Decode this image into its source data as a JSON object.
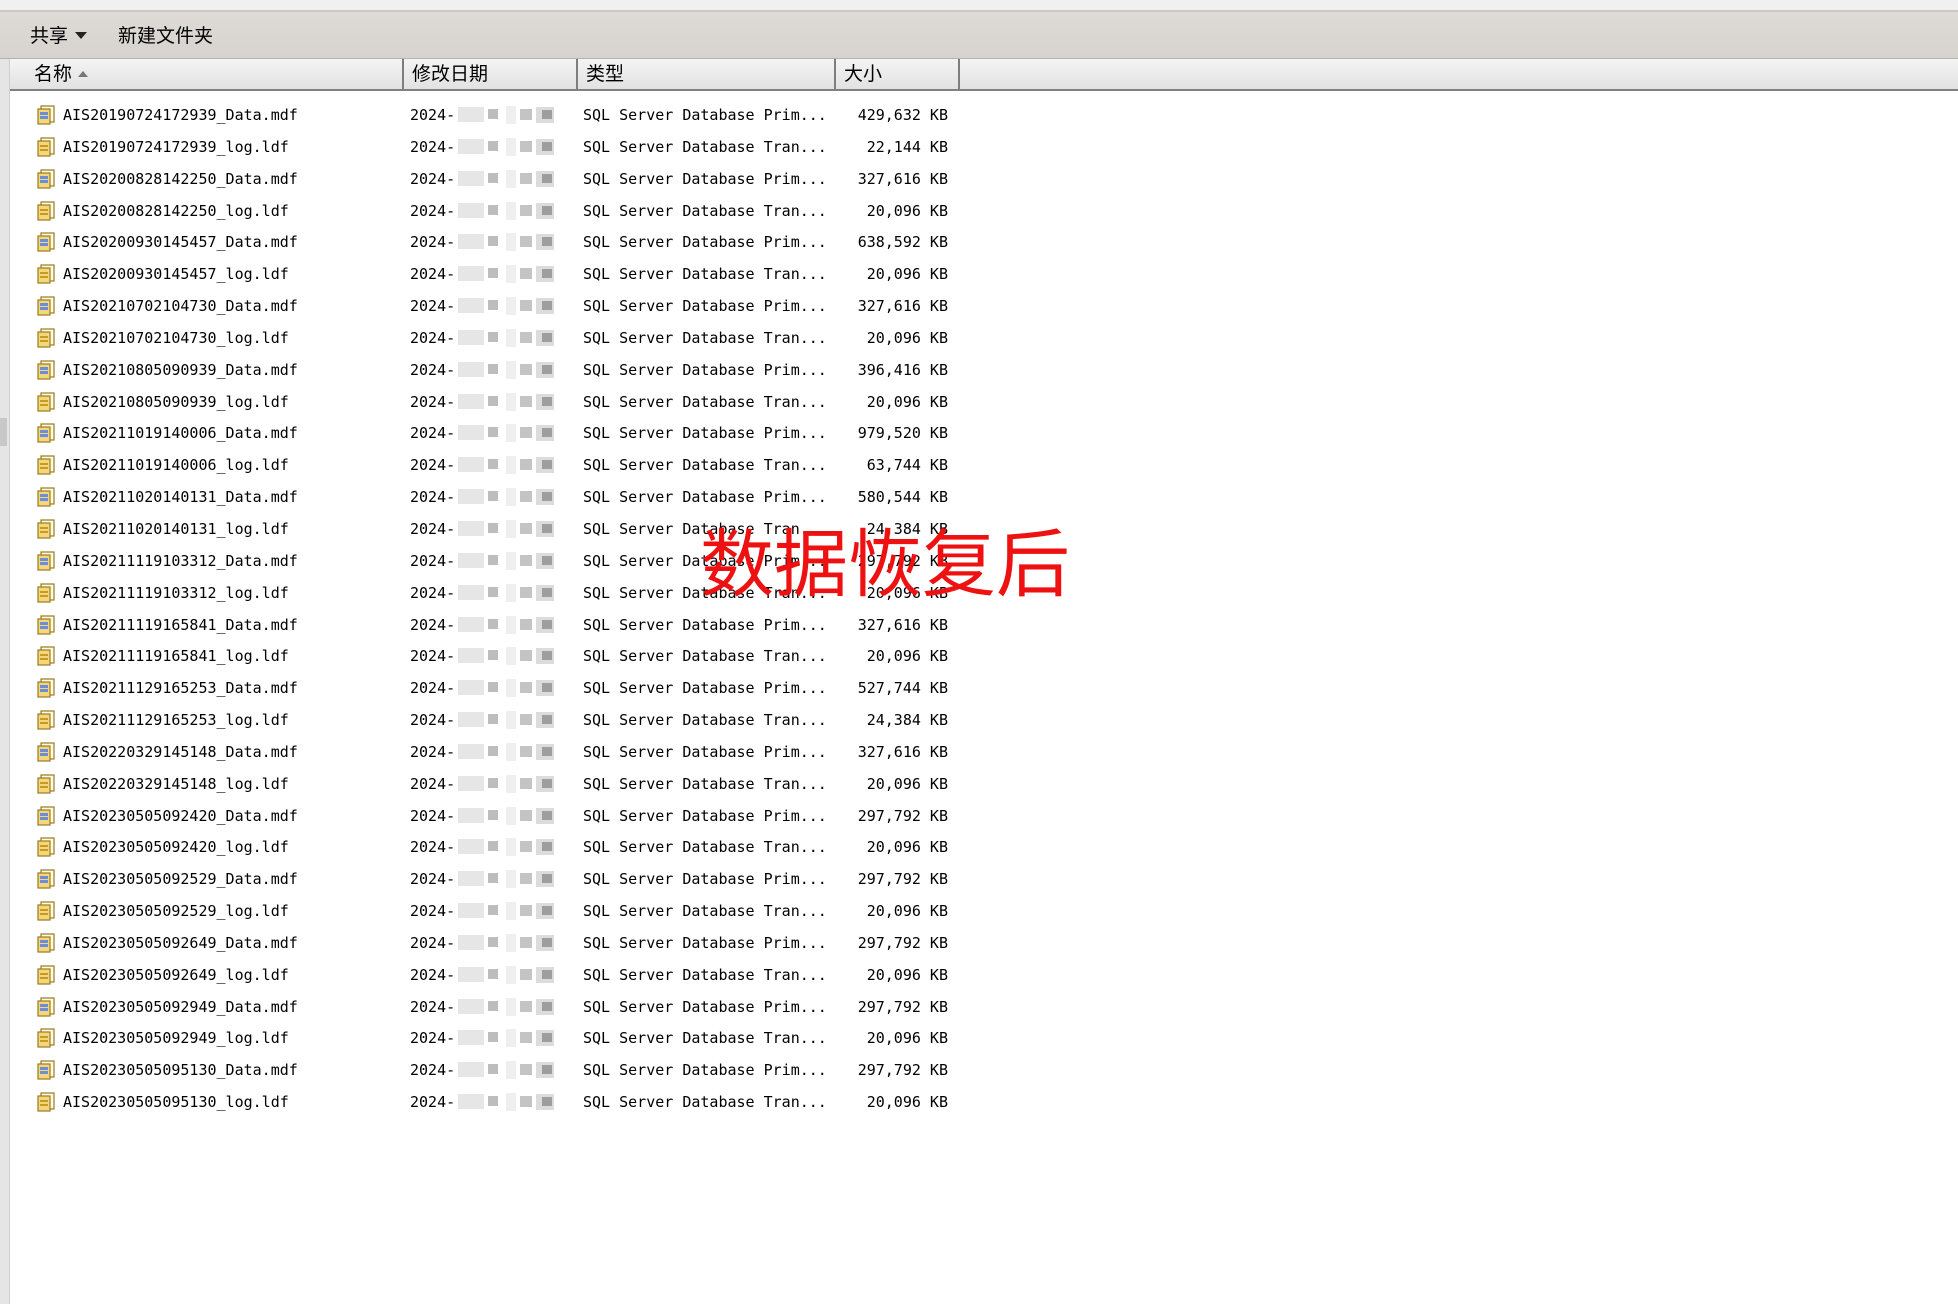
{
  "toolbar": {
    "share_label": "共享",
    "new_folder_label": "新建文件夹"
  },
  "columns": {
    "name": "名称",
    "date": "修改日期",
    "type": "类型",
    "size": "大小"
  },
  "overlay_text": "数据恢复后",
  "accent_color": "#ee1111",
  "files": [
    {
      "name": "AIS20190724172939_Data.mdf",
      "date": "2024-(",
      "type": "SQL Server Database Prim...",
      "size": "429,632 KB",
      "kind": "mdf-icon"
    },
    {
      "name": "AIS20190724172939_log.ldf",
      "date": "2024-(",
      "type": "SQL Server Database Tran...",
      "size": "22,144 KB",
      "kind": "ldf-icon"
    },
    {
      "name": "AIS20200828142250_Data.mdf",
      "date": "2024-(",
      "type": "SQL Server Database Prim...",
      "size": "327,616 KB",
      "kind": "mdf-icon"
    },
    {
      "name": "AIS20200828142250_log.ldf",
      "date": "2024-(",
      "type": "SQL Server Database Tran...",
      "size": "20,096 KB",
      "kind": "ldf-icon"
    },
    {
      "name": "AIS20200930145457_Data.mdf",
      "date": "2024-(",
      "type": "SQL Server Database Prim...",
      "size": "638,592 KB",
      "kind": "mdf-icon"
    },
    {
      "name": "AIS20200930145457_log.ldf",
      "date": "2024-(",
      "type": "SQL Server Database Tran...",
      "size": "20,096 KB",
      "kind": "ldf-icon"
    },
    {
      "name": "AIS20210702104730_Data.mdf",
      "date": "2024-(",
      "type": "SQL Server Database Prim...",
      "size": "327,616 KB",
      "kind": "mdf-icon"
    },
    {
      "name": "AIS20210702104730_log.ldf",
      "date": "2024-(",
      "type": "SQL Server Database Tran...",
      "size": "20,096 KB",
      "kind": "ldf-icon"
    },
    {
      "name": "AIS20210805090939_Data.mdf",
      "date": "2024-(",
      "type": "SQL Server Database Prim...",
      "size": "396,416 KB",
      "kind": "mdf-icon"
    },
    {
      "name": "AIS20210805090939_log.ldf",
      "date": "2024-(",
      "type": "SQL Server Database Tran...",
      "size": "20,096 KB",
      "kind": "ldf-icon"
    },
    {
      "name": "AIS20211019140006_Data.mdf",
      "date": "2024-(",
      "type": "SQL Server Database Prim...",
      "size": "979,520 KB",
      "kind": "mdf-icon"
    },
    {
      "name": "AIS20211019140006_log.ldf",
      "date": "2024-(",
      "type": "SQL Server Database Tran...",
      "size": "63,744 KB",
      "kind": "ldf-icon"
    },
    {
      "name": "AIS20211020140131_Data.mdf",
      "date": "2024-(",
      "type": "SQL Server Database Prim...",
      "size": "580,544 KB",
      "kind": "mdf-icon"
    },
    {
      "name": "AIS20211020140131_log.ldf",
      "date": "2024-(",
      "type": "SQL Server Database Tran...",
      "size": "24,384 KB",
      "kind": "ldf-icon"
    },
    {
      "name": "AIS20211119103312_Data.mdf",
      "date": "2024-(",
      "type": "SQL Server Database Prim...",
      "size": "297,792 KB",
      "kind": "mdf-icon"
    },
    {
      "name": "AIS20211119103312_log.ldf",
      "date": "2024-(",
      "type": "SQL Server Database Tran...",
      "size": "20,096 KB",
      "kind": "ldf-icon"
    },
    {
      "name": "AIS20211119165841_Data.mdf",
      "date": "2024-(",
      "type": "SQL Server Database Prim...",
      "size": "327,616 KB",
      "kind": "mdf-icon"
    },
    {
      "name": "AIS20211119165841_log.ldf",
      "date": "2024-(",
      "type": "SQL Server Database Tran...",
      "size": "20,096 KB",
      "kind": "ldf-icon"
    },
    {
      "name": "AIS20211129165253_Data.mdf",
      "date": "2024-(",
      "type": "SQL Server Database Prim...",
      "size": "527,744 KB",
      "kind": "mdf-icon"
    },
    {
      "name": "AIS20211129165253_log.ldf",
      "date": "2024-(",
      "type": "SQL Server Database Tran...",
      "size": "24,384 KB",
      "kind": "ldf-icon"
    },
    {
      "name": "AIS20220329145148_Data.mdf",
      "date": "2024-(",
      "type": "SQL Server Database Prim...",
      "size": "327,616 KB",
      "kind": "mdf-icon"
    },
    {
      "name": "AIS20220329145148_log.ldf",
      "date": "2024-(",
      "type": "SQL Server Database Tran...",
      "size": "20,096 KB",
      "kind": "ldf-icon"
    },
    {
      "name": "AIS20230505092420_Data.mdf",
      "date": "2024-(",
      "type": "SQL Server Database Prim...",
      "size": "297,792 KB",
      "kind": "mdf-icon"
    },
    {
      "name": "AIS20230505092420_log.ldf",
      "date": "2024-(",
      "type": "SQL Server Database Tran...",
      "size": "20,096 KB",
      "kind": "ldf-icon"
    },
    {
      "name": "AIS20230505092529_Data.mdf",
      "date": "2024-(",
      "type": "SQL Server Database Prim...",
      "size": "297,792 KB",
      "kind": "mdf-icon"
    },
    {
      "name": "AIS20230505092529_log.ldf",
      "date": "2024-(",
      "type": "SQL Server Database Tran...",
      "size": "20,096 KB",
      "kind": "ldf-icon"
    },
    {
      "name": "AIS20230505092649_Data.mdf",
      "date": "2024-(",
      "type": "SQL Server Database Prim...",
      "size": "297,792 KB",
      "kind": "mdf-icon"
    },
    {
      "name": "AIS20230505092649_log.ldf",
      "date": "2024-(",
      "type": "SQL Server Database Tran...",
      "size": "20,096 KB",
      "kind": "ldf-icon"
    },
    {
      "name": "AIS20230505092949_Data.mdf",
      "date": "2024-(",
      "type": "SQL Server Database Prim...",
      "size": "297,792 KB",
      "kind": "mdf-icon"
    },
    {
      "name": "AIS20230505092949_log.ldf",
      "date": "2024-(",
      "type": "SQL Server Database Tran...",
      "size": "20,096 KB",
      "kind": "ldf-icon"
    },
    {
      "name": "AIS20230505095130_Data.mdf",
      "date": "2024-(",
      "type": "SQL Server Database Prim...",
      "size": "297,792 KB",
      "kind": "mdf-icon"
    },
    {
      "name": "AIS20230505095130_log.ldf",
      "date": "2024-(",
      "type": "SQL Server Database Tran...",
      "size": "20,096 KB",
      "kind": "ldf-icon"
    }
  ]
}
